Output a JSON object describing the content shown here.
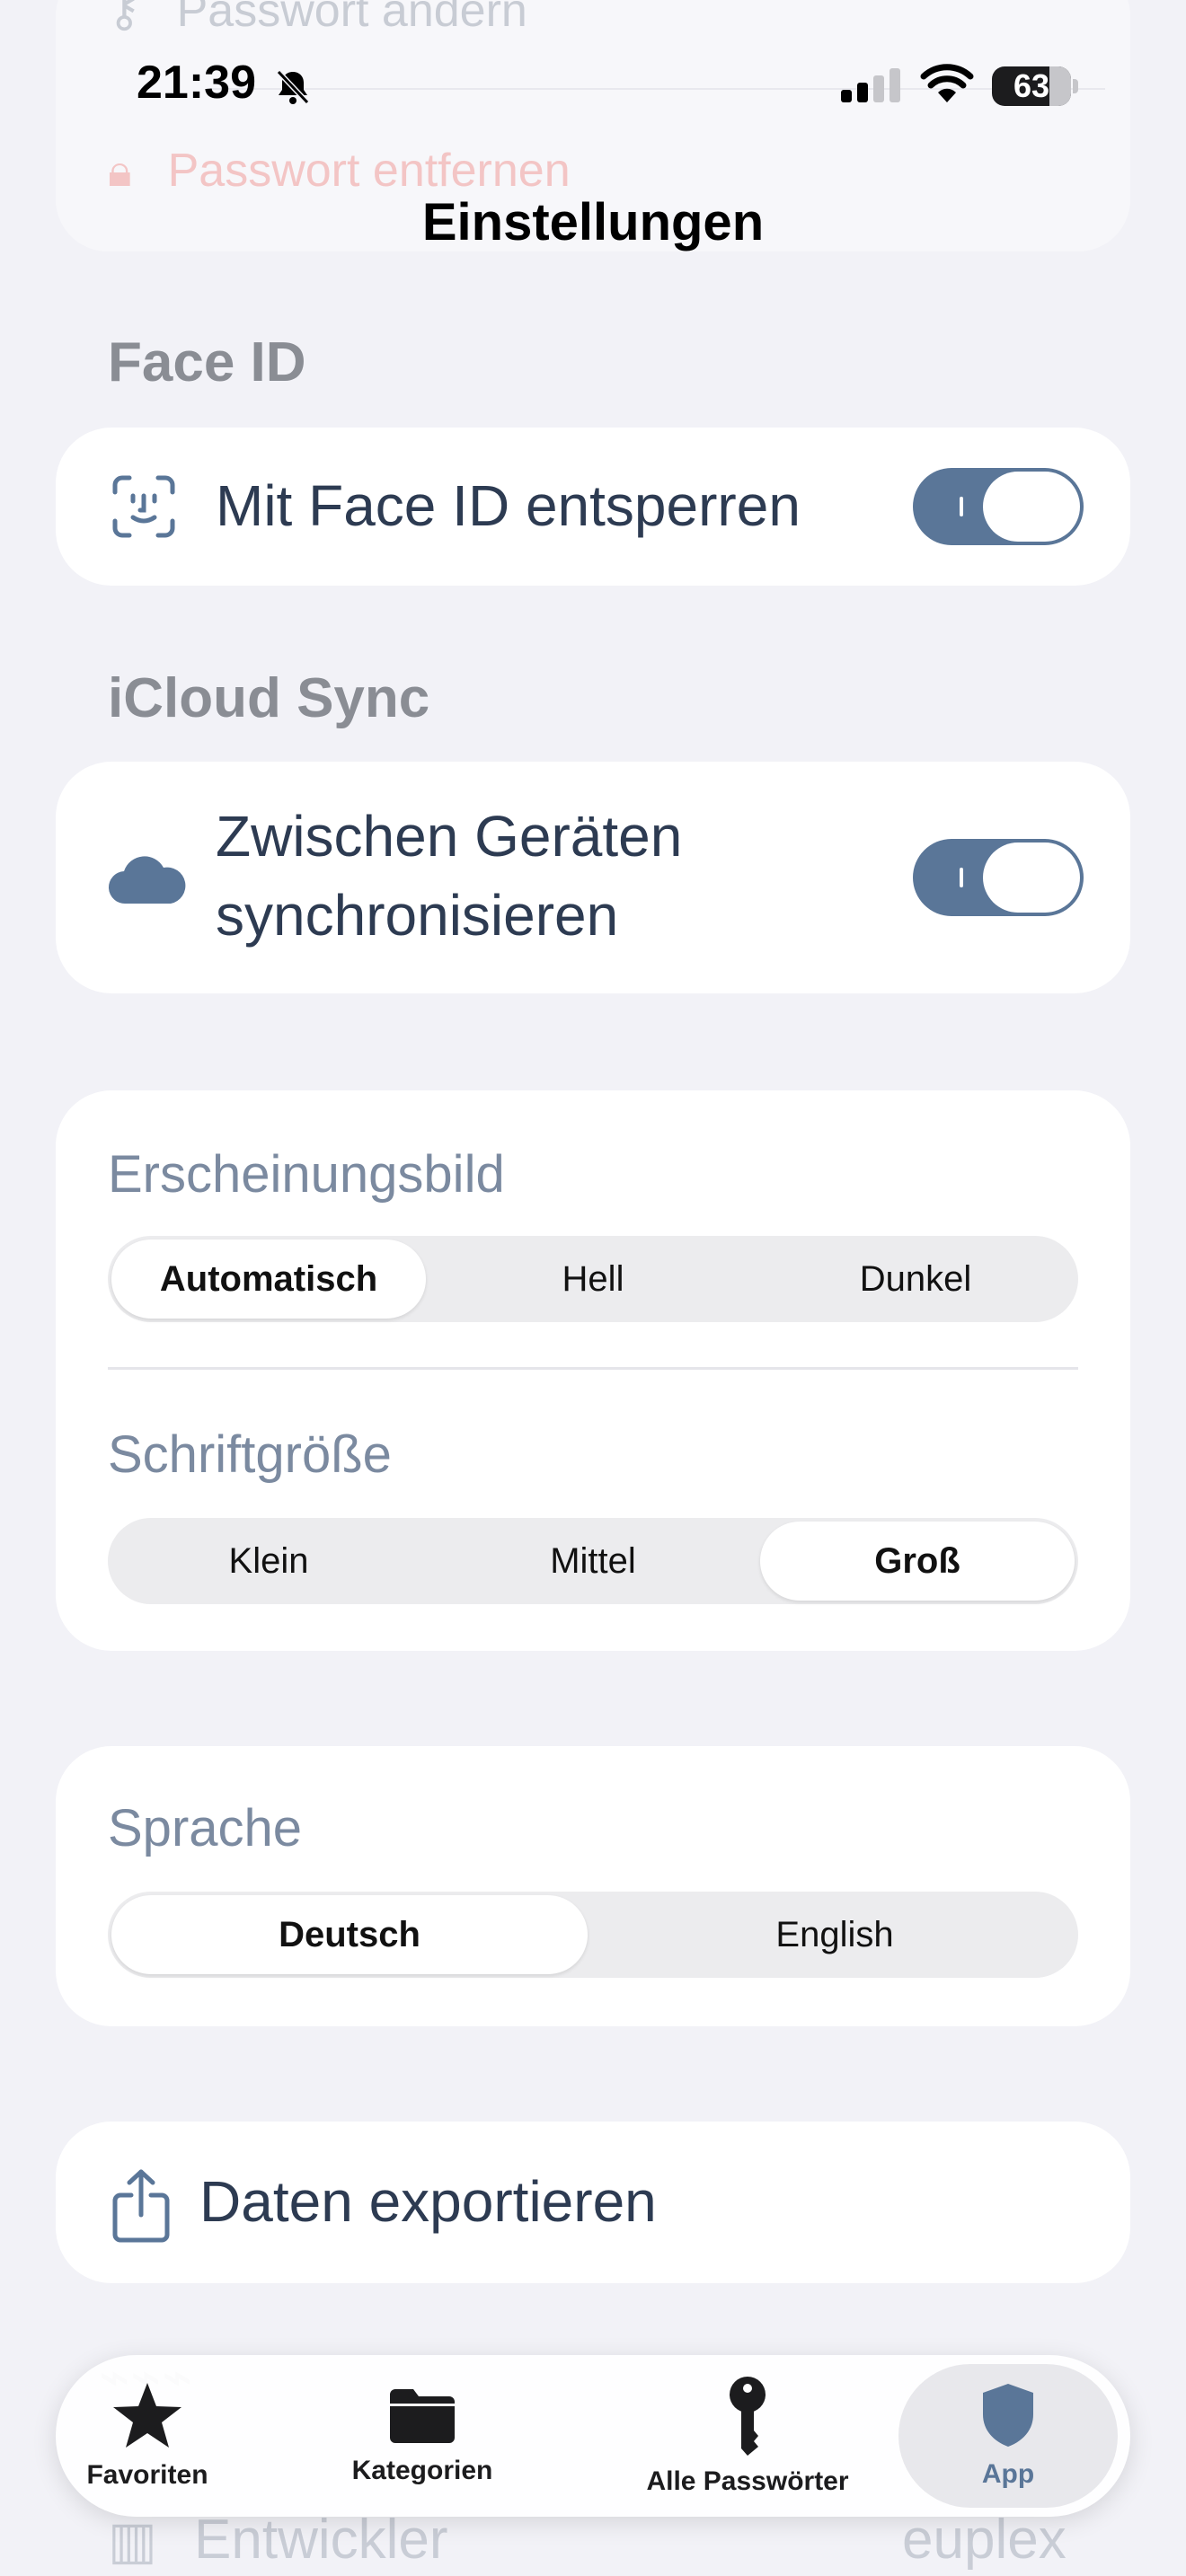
{
  "status_bar": {
    "time": "21:39",
    "battery": "63"
  },
  "background_rows": [
    {
      "label": "Passwort ändern"
    },
    {
      "label": "Passwort entfernen"
    }
  ],
  "nav": {
    "title": "Einstellungen"
  },
  "face_id": {
    "header": "Face ID",
    "row_label": "Mit Face ID entsperren",
    "enabled": true
  },
  "icloud": {
    "header": "iCloud Sync",
    "row_label_line1": "Zwischen Geräten",
    "row_label_line2": "synchronisieren",
    "enabled": true
  },
  "appearance": {
    "label": "Erscheinungsbild",
    "options": [
      "Automatisch",
      "Hell",
      "Dunkel"
    ],
    "selected": "Automatisch"
  },
  "font_size": {
    "label": "Schriftgröße",
    "options": [
      "Klein",
      "Mittel",
      "Groß"
    ],
    "selected": "Groß"
  },
  "language": {
    "label": "Sprache",
    "options": [
      "Deutsch",
      "English"
    ],
    "selected": "Deutsch"
  },
  "export": {
    "label": "Daten exportieren"
  },
  "bottom_rows": {
    "developer_label": "Entwickler",
    "developer_value": "euplex"
  },
  "tab_bar": {
    "items": [
      {
        "label": "Favoriten",
        "icon": "star-icon"
      },
      {
        "label": "Kategorien",
        "icon": "folder-icon"
      },
      {
        "label": "Alle Passwörter",
        "icon": "key-icon"
      },
      {
        "label": "App",
        "icon": "shield-icon"
      }
    ],
    "active": "App"
  },
  "colors": {
    "accent": "#5a7698",
    "background": "#f2f2f7",
    "text": "#2d3b52",
    "section_header": "#8a8d94"
  }
}
